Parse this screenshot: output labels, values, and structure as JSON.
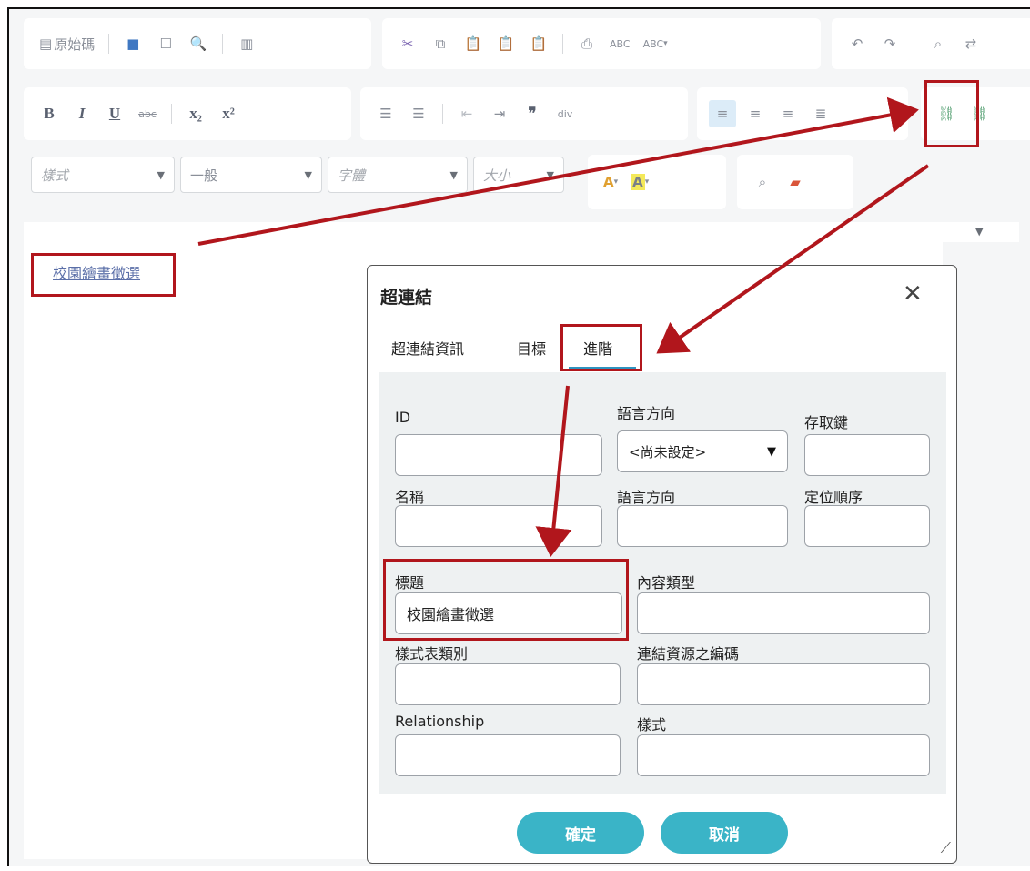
{
  "toolbar": {
    "source_label": "原始碼",
    "abc": "ABC",
    "style_combo": "樣式",
    "format_combo": "一般",
    "font_combo": "字體",
    "size_combo": "大小",
    "chevron": "▼"
  },
  "editor": {
    "link_text": "校園繪畫徵選"
  },
  "dialog": {
    "title": "超連結",
    "close": "✕",
    "tabs": [
      "超連結資訊",
      "目標",
      "進階"
    ],
    "fields": {
      "id_label": "ID",
      "lang_dir_label": "語言方向",
      "lang_dir_value": "<尚未設定>",
      "access_key_label": "存取鍵",
      "name_label": "名稱",
      "lang_dir2_label": "語言方向",
      "tab_index_label": "定位順序",
      "title_label": "標題",
      "title_value": "校園繪畫徵選",
      "content_type_label": "內容類型",
      "stylesheet_label": "樣式表類別",
      "charset_label": "連結資源之編碼",
      "relationship_label": "Relationship",
      "style_label": "樣式"
    },
    "ok": "確定",
    "cancel": "取消"
  },
  "colors": {
    "highlight": "#b1161c",
    "button": "#3ab4c7",
    "tab_underline": "#2f93bf"
  }
}
